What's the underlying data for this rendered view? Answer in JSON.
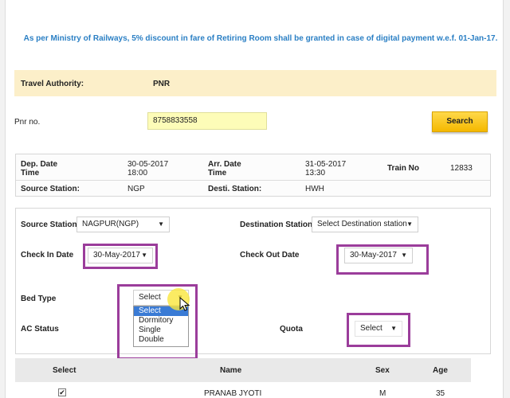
{
  "notice": "As per Ministry of Railways, 5% discount in fare of Retiring Room shall be granted in case of digital payment w.e.f. 01-Jan-17.",
  "travel_authority": {
    "label": "Travel Authority:",
    "value": "PNR"
  },
  "pnr": {
    "label": "Pnr no.",
    "value": "8758833558",
    "search_label": "Search"
  },
  "train_info": {
    "dep_date_label": "Dep. Date",
    "dep_time_label": "Time",
    "dep_date": "30-05-2017",
    "dep_time": "18:00",
    "arr_date_label": "Arr. Date",
    "arr_time_label": "Time",
    "arr_date": "31-05-2017",
    "arr_time": "13:30",
    "train_no_label": "Train No",
    "train_no": "12833",
    "source_label": "Source Station:",
    "source": "NGP",
    "dest_label": "Desti. Station:",
    "dest": "HWH"
  },
  "form": {
    "source_station_label": "Source Station",
    "source_station_value": "NAGPUR(NGP)",
    "destination_station_label": "Destination Station",
    "destination_station_value": "Select Destination station",
    "check_in_label": "Check In Date",
    "check_in_value": "30-May-2017",
    "check_out_label": "Check Out Date",
    "check_out_value": "30-May-2017",
    "bed_type_label": "Bed Type",
    "bed_type_value": "Select",
    "bed_type_options": [
      "Select",
      "Dormitory",
      "Single",
      "Double"
    ],
    "ac_status_label": "AC Status",
    "quota_label": "Quota",
    "quota_value": "Select"
  },
  "passenger_table": {
    "headers": [
      "Select",
      "Name",
      "Sex",
      "Age"
    ],
    "rows": [
      {
        "name": "PRANAB JYOTI",
        "sex": "M",
        "age": "35",
        "checked": "✔"
      }
    ]
  },
  "highlight_color": "#9b3d9b",
  "icons": {
    "dropdown": "caret-down-icon",
    "cursor": "mouse-pointer-icon"
  }
}
